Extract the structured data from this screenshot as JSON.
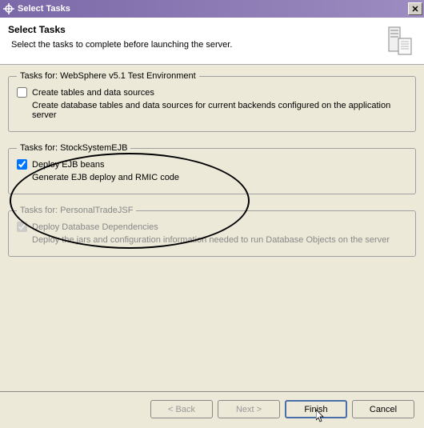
{
  "titlebar": {
    "title": "Select Tasks",
    "close_label": "X"
  },
  "header": {
    "title": "Select Tasks",
    "subtitle": "Select the tasks to complete before launching the server."
  },
  "groups": [
    {
      "legend": "Tasks for: WebSphere v5.1 Test Environment",
      "checkbox_label": "Create tables and data sources",
      "checked": false,
      "disabled": false,
      "description": "Create database tables and data sources for current backends configured on the application server"
    },
    {
      "legend": "Tasks for: StockSystemEJB",
      "checkbox_label": "Deploy EJB beans",
      "checked": true,
      "disabled": false,
      "description": "Generate EJB deploy and RMIC code"
    },
    {
      "legend": "Tasks for: PersonalTradeJSF",
      "checkbox_label": "Deploy Database Dependencies",
      "checked": true,
      "disabled": true,
      "description": "Deploy the jars and configuration information needed to run Database Objects on the server"
    }
  ],
  "buttons": {
    "back": "< Back",
    "next": "Next >",
    "finish": "Finish",
    "cancel": "Cancel"
  }
}
